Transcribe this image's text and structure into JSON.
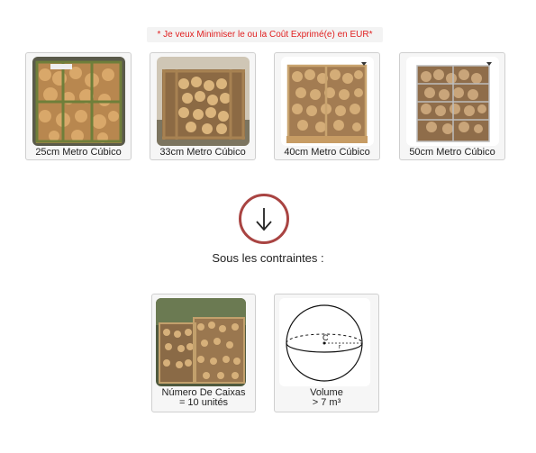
{
  "banner_text": "* Je veux Minimiser le ou la Coût Exprimé(e) en EUR*",
  "options": [
    {
      "label": "25cm Metro Cúbico",
      "icon": "firewood-crate-25cm-image"
    },
    {
      "label": "33cm Metro Cúbico",
      "icon": "firewood-crate-33cm-image"
    },
    {
      "label": "40cm Metro Cúbico",
      "icon": "firewood-crate-40cm-image"
    },
    {
      "label": "50cm Metro Cúbico",
      "icon": "firewood-crate-50cm-image"
    }
  ],
  "arrow_icon": "arrow-down-icon",
  "constraints_title": "Sous les contraintes :",
  "constraints": [
    {
      "line1": "Número De Caixas",
      "line2": "= 10 unités",
      "icon": "firewood-boxes-image"
    },
    {
      "line1": "Volume",
      "line2": "> 7 m³",
      "icon": "sphere-volume-image"
    }
  ],
  "sphere_center_label": "C",
  "sphere_radius_label": "r",
  "colors": {
    "banner_text": "#e02020",
    "arrow_circle": "#a94442"
  }
}
